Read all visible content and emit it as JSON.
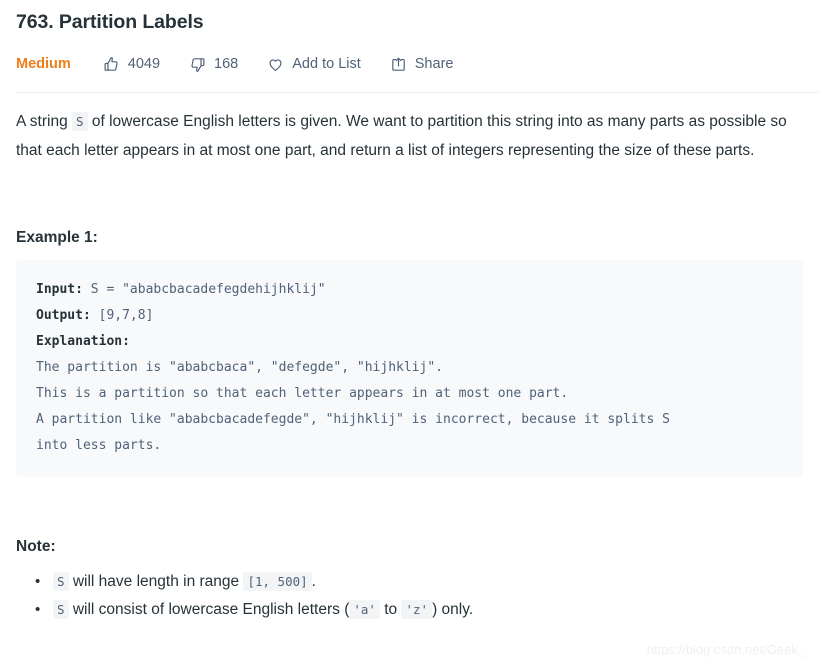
{
  "problem": {
    "title": "763. Partition Labels",
    "difficulty": "Medium"
  },
  "toolbar": {
    "likes": "4049",
    "dislikes": "168",
    "add_to_list_label": "Add to List",
    "share_label": "Share",
    "icons": {
      "like": "thumbs-up-icon",
      "dislike": "thumbs-down-icon",
      "favorite": "heart-icon",
      "share": "share-icon"
    }
  },
  "description": {
    "part1": "A string ",
    "code1": "S",
    "part2": " of lowercase English letters is given. We want to partition this string into as many parts as possible so that each letter appears in at most one part, and return a list of integers representing the size of these parts."
  },
  "example": {
    "heading": "Example 1:",
    "lines": [
      {
        "label": "Input:",
        "text": " S = \"ababcbacadefegdehijhklij\""
      },
      {
        "label": "Output:",
        "text": " [9,7,8]"
      },
      {
        "label": "Explanation:",
        "text": ""
      },
      {
        "label": "",
        "text": "The partition is \"ababcbaca\", \"defegde\", \"hijhklij\"."
      },
      {
        "label": "",
        "text": "This is a partition so that each letter appears in at most one part."
      },
      {
        "label": "",
        "text": "A partition like \"ababcbacadefegde\", \"hijhklij\" is incorrect, because it splits S"
      },
      {
        "label": "",
        "text": "into less parts."
      }
    ]
  },
  "note": {
    "heading": "Note:",
    "bullet1": {
      "code_s": "S",
      "text_mid": " will have length in range ",
      "code_range": "[1, 500]",
      "text_end": "."
    },
    "bullet2": {
      "code_s": "S",
      "text_mid": " will consist of lowercase English letters (",
      "code_a": "'a'",
      "text_to": " to ",
      "code_z": "'z'",
      "text_end": ") only."
    }
  },
  "watermark": "https://blog.csdn.net/Geek_"
}
